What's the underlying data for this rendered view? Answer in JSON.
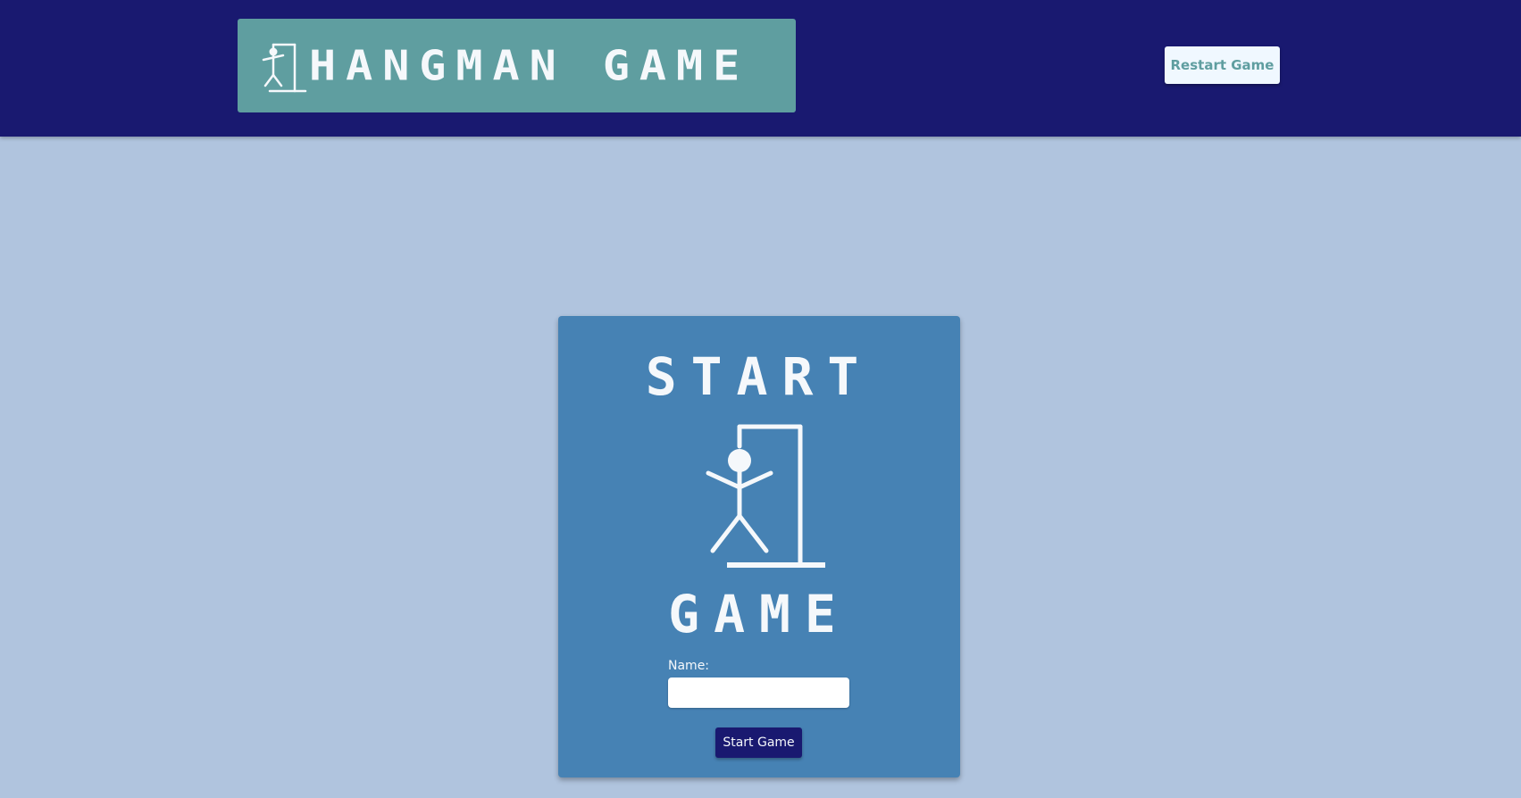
{
  "header": {
    "logo_text": "HANGMAN GAME",
    "logo_icon": "hangman-icon",
    "restart_label": "Restart Game"
  },
  "start_card": {
    "title_top": "START",
    "title_bottom": "GAME",
    "figure_icon": "hangman-icon",
    "name_label": "Name:",
    "name_value": "",
    "start_label": "Start Game"
  },
  "colors": {
    "header_bg": "#191970",
    "page_bg": "#b0c4de",
    "logo_bg": "#5f9ea0",
    "card_bg": "#4682b4",
    "text_light": "#f5f8fb",
    "restart_bg": "#f0f8ff",
    "start_btn_bg": "#191970"
  }
}
